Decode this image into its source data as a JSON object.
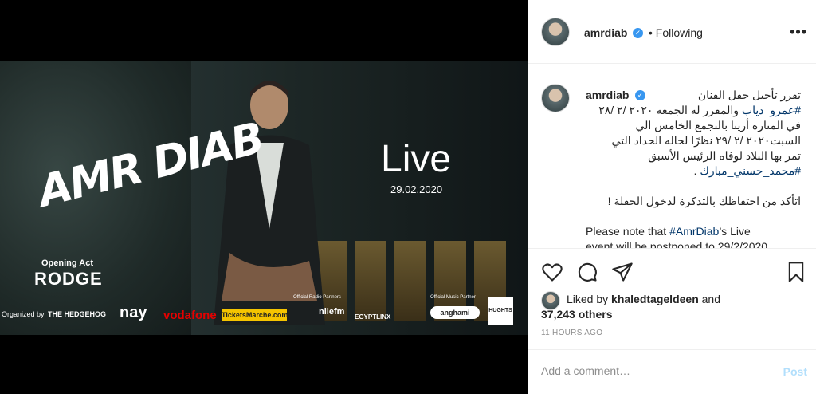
{
  "poster": {
    "artist_logo": "AMR DIAB",
    "live_title": "Live",
    "live_date": "29.02.2020",
    "opening_act_label": "Opening Act",
    "opening_act": "RODGE",
    "organized_by": "Organized by",
    "sponsors": [
      "THE HEDGEHOG",
      "nay",
      "vodafone",
      "TicketsMarche.com",
      "Official Radio Partners",
      "nilefm",
      "EGYPTLINX",
      "Official Music Partner",
      "anghami",
      "HUGHTS"
    ]
  },
  "header": {
    "username": "amrdiab",
    "separator": "•",
    "follow_status": "Following",
    "more_icon": "more-horizontal-icon"
  },
  "caption": {
    "username": "amrdiab",
    "ar_line1": "تقرر تأجيل حفل الفنان",
    "ar_hashtag_name": "#عمرو_دياب",
    "ar_line2": "والمقرر له الجمعه ٢٠٢٠ /٢ /٢٨",
    "ar_line3": "في المناره أرينا بالتجمع الخامس الي",
    "ar_line4": "السبت٢٠٢٠ /٢ /٢٩ نظرًا لحاله الحداد التي",
    "ar_line5": "تمر بها البلاد لوفاه الرئيس الأسبق",
    "ar_hashtag_president": "#محمد_حسني_مبارك",
    "ar_line6": ".",
    "ar_ticket_note": "اتأكد من احتفاظك بالتذكرة لدخول الحفلة !",
    "en_prefix": "Please note that",
    "en_hashtag": "#AmrDiab",
    "en_suffix": "’s Live",
    "en_line2": "event will be postponed to 29/2/2020"
  },
  "actions": {
    "like_icon": "heart-icon",
    "comment_icon": "comment-icon",
    "share_icon": "share-icon",
    "save_icon": "bookmark-icon"
  },
  "likes": {
    "prefix": "Liked by",
    "user": "khaledtageldeen",
    "and": "and",
    "others": "37,243 others"
  },
  "timestamp": "11 HOURS AGO",
  "comment": {
    "placeholder": "Add a comment…",
    "post_label": "Post"
  }
}
